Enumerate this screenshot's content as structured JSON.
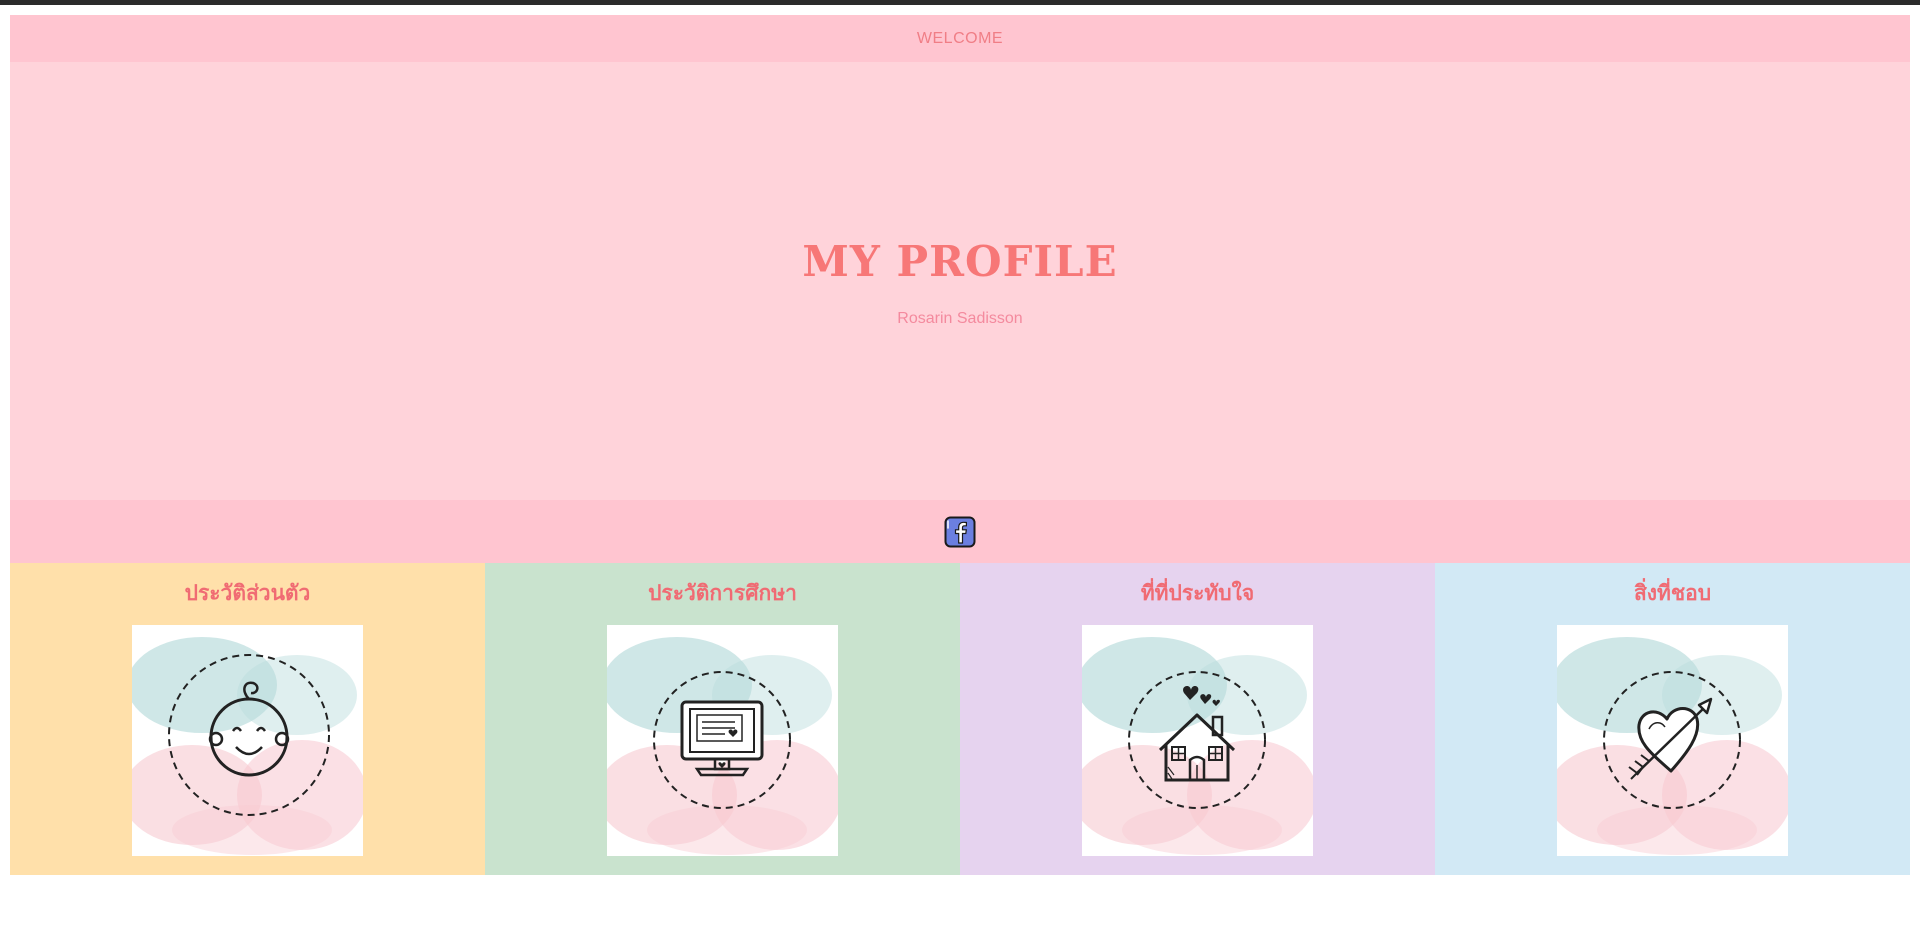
{
  "header": {
    "welcome": "WELCOME"
  },
  "hero": {
    "title": "MY PROFILE",
    "subtitle": "Rosarin Sadisson"
  },
  "social": {
    "icon": "facebook-icon",
    "color": "#6b7fe0"
  },
  "cards": [
    {
      "title": "ประวัติส่วนตัว",
      "icon": "baby-face-icon",
      "background": "#ffe0aa"
    },
    {
      "title": "ประวัติการศึกษา",
      "icon": "computer-monitor-icon",
      "background": "#c9e3ce"
    },
    {
      "title": "ที่ที่ประทับใจ",
      "icon": "house-icon",
      "background": "#e6d3ef"
    },
    {
      "title": "สิ่งที่ชอบ",
      "icon": "heart-arrow-icon",
      "background": "#d2e9f5"
    }
  ],
  "colors": {
    "accent": "#f77777",
    "bar": "#ffc5d0",
    "hero_bg": "#ffd3da"
  }
}
